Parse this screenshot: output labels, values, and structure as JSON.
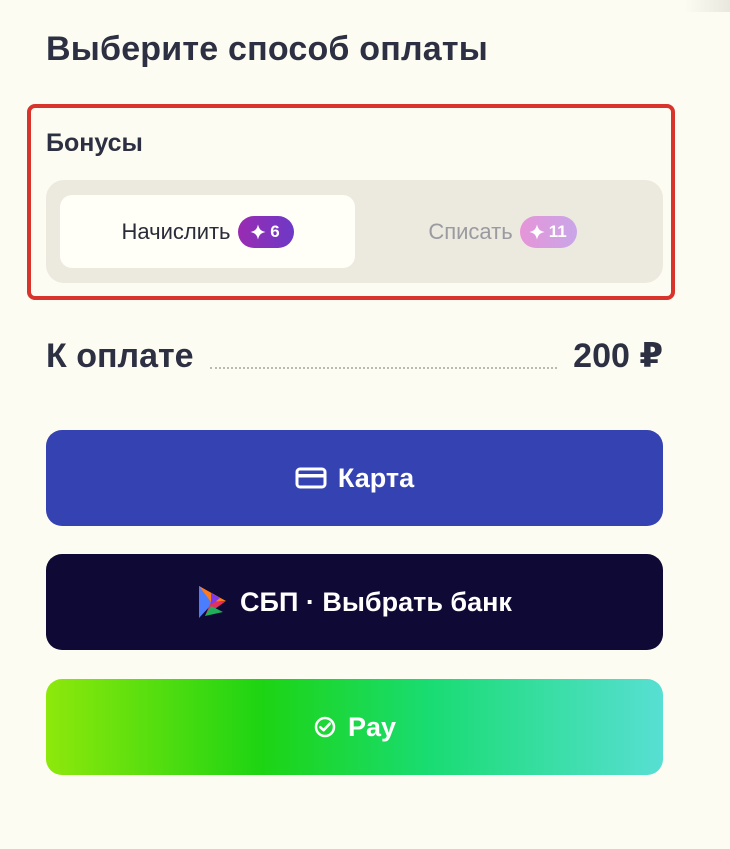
{
  "payment": {
    "title": "Выберите способ оплаты"
  },
  "bonuses": {
    "title": "Бонусы",
    "selected": "accrue",
    "options": [
      {
        "label": "Начислить",
        "amount": "6",
        "icon": "sparkle-icon",
        "active": true
      },
      {
        "label": "Списать",
        "amount": "11",
        "icon": "sparkle-icon",
        "active": false
      }
    ]
  },
  "total": {
    "label": "К оплате",
    "amount": "200 ₽"
  },
  "buttons": {
    "card": {
      "label": "Карта",
      "icon": "credit-card-icon",
      "color": "#3543b2"
    },
    "sbp": {
      "label": "СБП · Выбрать банк",
      "icon": "sbp-logo-icon",
      "color": "#0f0935"
    },
    "pay": {
      "label": "Pay",
      "icon": "check-circle-icon",
      "gradient": [
        "#8ee80b",
        "#1dd413",
        "#19dc72",
        "#57dfd3"
      ]
    }
  },
  "colors": {
    "background": "#fdfcf2",
    "highlight": "#d9342b",
    "active_badge": "#7f33c0",
    "inactive_badge": "#d8a0e1"
  }
}
